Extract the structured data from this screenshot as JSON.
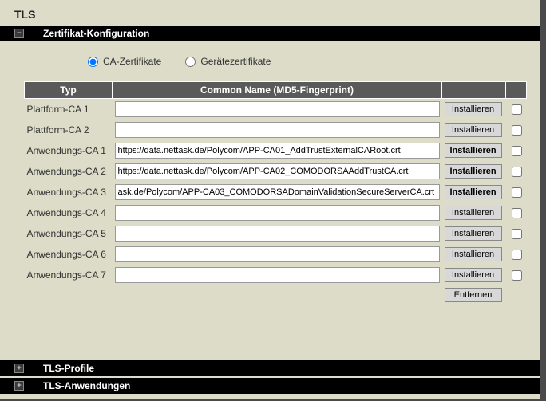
{
  "page_title": "TLS",
  "section_config_title": "Zertifikat-Konfiguration",
  "radio": {
    "ca_label": "CA-Zertifikate",
    "device_label": "Gerätezertifikate"
  },
  "table": {
    "col_type": "Typ",
    "col_cn": "Common Name (MD5-Fingerprint)"
  },
  "btn_install": "Installieren",
  "btn_remove": "Entfernen",
  "rows": [
    {
      "typ": "Plattform-CA 1",
      "val": "",
      "bold": false
    },
    {
      "typ": "Plattform-CA 2",
      "val": "",
      "bold": false
    },
    {
      "typ": "Anwendungs-CA 1",
      "val": "https://data.nettask.de/Polycom/APP-CA01_AddTrustExternalCARoot.crt",
      "bold": true
    },
    {
      "typ": "Anwendungs-CA 2",
      "val": "https://data.nettask.de/Polycom/APP-CA02_COMODORSAAddTrustCA.crt",
      "bold": true
    },
    {
      "typ": "Anwendungs-CA 3",
      "val": "ask.de/Polycom/APP-CA03_COMODORSADomainValidationSecureServerCA.crt",
      "bold": true
    },
    {
      "typ": "Anwendungs-CA 4",
      "val": "",
      "bold": false
    },
    {
      "typ": "Anwendungs-CA 5",
      "val": "",
      "bold": false
    },
    {
      "typ": "Anwendungs-CA 6",
      "val": "",
      "bold": false
    },
    {
      "typ": "Anwendungs-CA 7",
      "val": "",
      "bold": false
    }
  ],
  "section_profiles_title": "TLS-Profile",
  "section_apps_title": "TLS-Anwendungen"
}
